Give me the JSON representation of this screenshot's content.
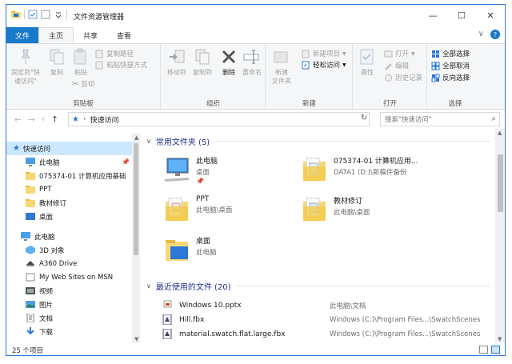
{
  "window": {
    "title": "文件资源管理器",
    "controls": {
      "minimize": "—",
      "maximize": "☐",
      "close": "✕"
    }
  },
  "ribbon": {
    "tabs": [
      {
        "label": "文件",
        "active": false
      },
      {
        "label": "主页",
        "active": true
      },
      {
        "label": "共享",
        "active": false
      },
      {
        "label": "查看",
        "active": false
      }
    ],
    "collapse_icon": "∨",
    "help_icon": "?",
    "groups": {
      "clipboard": {
        "label": "剪贴板",
        "pin_quick": "固定到\"快\n速访问\"",
        "copy": "复制",
        "paste": "粘贴",
        "copy_path": "复制路径",
        "paste_shortcut": "粘贴快捷方式",
        "cut": "剪切"
      },
      "organize": {
        "label": "组织",
        "move_to": "移动到",
        "copy_to": "复制到",
        "delete": "删除",
        "rename": "重命名"
      },
      "new": {
        "label": "新建",
        "new_folder": "新建\n文件夹",
        "new_item": "新建项目",
        "easy_access": "轻松访问"
      },
      "open": {
        "label": "打开",
        "properties": "属性",
        "open": "打开",
        "edit": "编辑",
        "history": "历史记录"
      },
      "select": {
        "label": "选择",
        "select_all": "全部选择",
        "select_none": "全部取消",
        "invert": "反向选择"
      }
    }
  },
  "address": {
    "path": "快速访问",
    "search_placeholder": "搜索\"快速访问\""
  },
  "nav": {
    "items": [
      {
        "label": "快速访问",
        "icon": "star-icon",
        "selected": true,
        "indent": 0
      },
      {
        "label": "此电脑",
        "icon": "monitor-icon",
        "pinned": true,
        "indent": 1
      },
      {
        "label": "075374-01 计算机应用基础",
        "icon": "folder-icon",
        "indent": 1
      },
      {
        "label": "PPT",
        "icon": "folder-icon",
        "indent": 1
      },
      {
        "label": "教材修订",
        "icon": "folder-icon",
        "indent": 1
      },
      {
        "label": "桌面",
        "icon": "desktop-icon",
        "indent": 1
      },
      {
        "label": "此电脑",
        "icon": "monitor-icon",
        "indent": 0
      },
      {
        "label": "3D 对象",
        "icon": "3d-objects-icon",
        "indent": 1
      },
      {
        "label": "A360 Drive",
        "icon": "cloud-drive-icon",
        "indent": 1
      },
      {
        "label": "My Web Sites on MSN",
        "icon": "web-sites-icon",
        "indent": 1
      },
      {
        "label": "视频",
        "icon": "video-icon",
        "indent": 1
      },
      {
        "label": "图片",
        "icon": "pictures-icon",
        "indent": 1
      },
      {
        "label": "文档",
        "icon": "documents-icon",
        "indent": 1
      },
      {
        "label": "下载",
        "icon": "download-icon",
        "indent": 1
      }
    ]
  },
  "main": {
    "frequent_header": "常用文件夹 (5)",
    "frequent": [
      {
        "name": "此电脑",
        "sub": "桌面",
        "pin": "📌",
        "icon": "computer-icon"
      },
      {
        "name": "075374-01 计算机应用...",
        "sub": "DATA1 (D:)\\新稿件备份",
        "icon": "folder-docs-icon"
      },
      {
        "name": "PPT",
        "sub": "此电脑\\桌面",
        "icon": "folder-docs-icon"
      },
      {
        "name": "教材修订",
        "sub": "此电脑\\桌面",
        "icon": "folder-docs-icon"
      },
      {
        "name": "桌面",
        "sub": "此电脑",
        "icon": "desktop-folder-icon"
      }
    ],
    "recent_header": "最近使用的文件 (20)",
    "recent": [
      {
        "name": "Windows 10.pptx",
        "location": "此电脑\\文档",
        "icon": "pptx-file-icon"
      },
      {
        "name": "Hill.fbx",
        "location": "Windows (C:)\\Program Files...\\SwatchScenes",
        "icon": "fbx-file-icon"
      },
      {
        "name": "material.swatch.flat.large.fbx",
        "location": "Windows (C:)\\Program Files...\\SwatchScenes",
        "icon": "fbx-file-icon"
      }
    ]
  },
  "status": {
    "count": "25 个项目"
  },
  "colors": {
    "accent": "#1979ca",
    "selection": "#cce8ff",
    "header_text": "#1e3287",
    "folder": "#f8d775"
  }
}
